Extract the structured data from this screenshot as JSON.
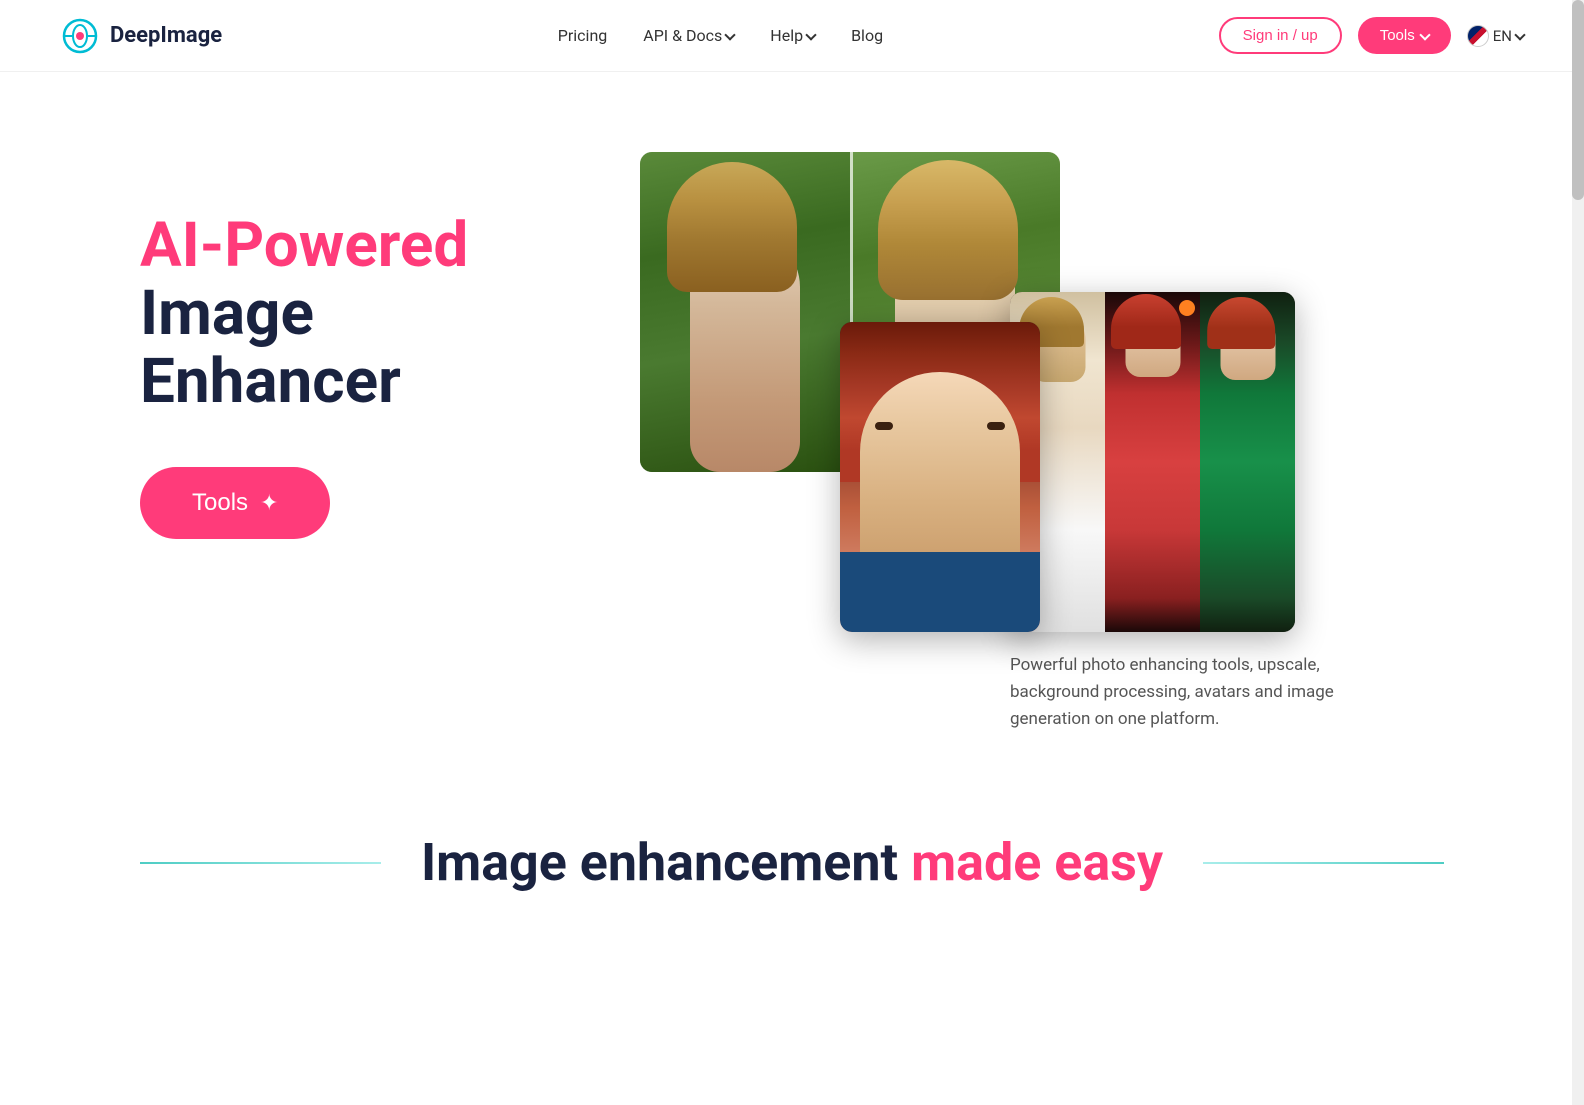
{
  "logo": {
    "text": "DeepImage"
  },
  "navbar": {
    "pricing": "Pricing",
    "api_docs": "API & Docs",
    "help": "Help",
    "blog": "Blog",
    "signin": "Sign in / up",
    "tools": "Tools",
    "lang": "EN"
  },
  "hero": {
    "title_line1": "AI-Powered",
    "title_line2": "Image Enhancer",
    "cta_button": "Tools",
    "description": "Powerful photo enhancing tools, upscale, background processing, avatars and image generation on one platform."
  },
  "section": {
    "heading_static": "Image enhancement",
    "heading_pink": "made easy"
  }
}
